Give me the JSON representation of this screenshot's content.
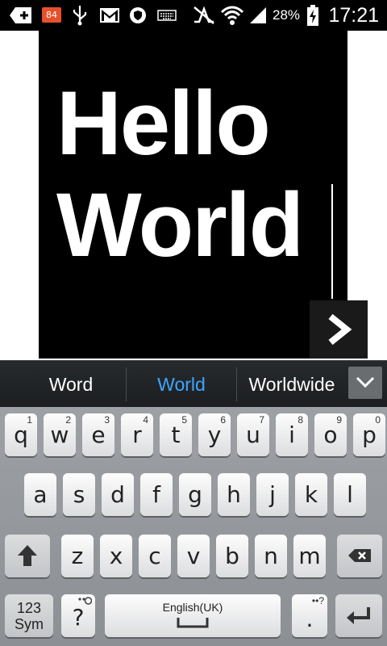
{
  "status_bar": {
    "notification_count": "84",
    "battery_percent": "28%",
    "time": "17:21"
  },
  "canvas": {
    "text": "Hello\nWorld"
  },
  "suggestions": {
    "items": [
      "Word",
      "World",
      "Worldwide"
    ],
    "active_index": 1
  },
  "keyboard": {
    "row1": [
      {
        "label": "q",
        "hint": "1"
      },
      {
        "label": "w",
        "hint": "2"
      },
      {
        "label": "e",
        "hint": "3"
      },
      {
        "label": "r",
        "hint": "4"
      },
      {
        "label": "t",
        "hint": "5"
      },
      {
        "label": "y",
        "hint": "6"
      },
      {
        "label": "u",
        "hint": "7"
      },
      {
        "label": "i",
        "hint": "8"
      },
      {
        "label": "o",
        "hint": "9"
      },
      {
        "label": "p",
        "hint": "0"
      }
    ],
    "row2": [
      "a",
      "s",
      "d",
      "f",
      "g",
      "h",
      "j",
      "k",
      "l"
    ],
    "row3": [
      "z",
      "x",
      "c",
      "v",
      "b",
      "n",
      "m"
    ],
    "sym_label_line1": "123",
    "sym_label_line2": "Sym",
    "question_label": "?",
    "space_label": "English(UK)",
    "period_label": ".",
    "period_hint": "••?"
  },
  "colors": {
    "accent_suggestion": "#3ea6ff",
    "notification_badge": "#e8502c"
  }
}
